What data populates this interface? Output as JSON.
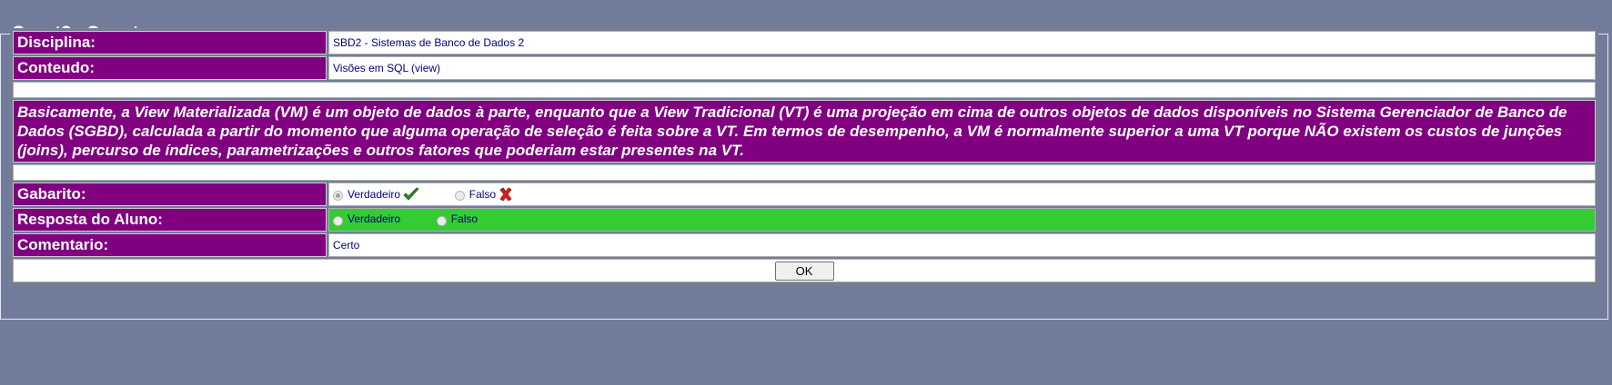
{
  "legend": "Quest?o Correta",
  "rows": {
    "disciplina_label": "Disciplina:",
    "disciplina_value": "SBD2 - Sistemas de Banco de Dados 2",
    "conteudo_label": "Conteudo:",
    "conteudo_value": "Visões em SQL (view)",
    "question_text": "Basicamente, a View Materializada (VM) é um objeto de dados à parte, enquanto que a View Tradicional (VT) é uma projeção em cima de outros objetos de dados disponíveis no Sistema Gerenciador de Banco de Dados (SGBD), calculada a partir do momento que alguma operação de seleção é feita sobre a VT.     Em termos de desempenho, a VM é normalmente superior a uma VT porque NÃO existem os custos de junções (joins), percurso de índices, parametrizações e outros fatores que poderiam estar presentes na VT.",
    "gabarito_label": "Gabarito:",
    "resposta_label": "Resposta do Aluno:",
    "comentario_label": "Comentario:",
    "comentario_value": "Certo"
  },
  "gabarito": {
    "option_true": "Verdadeiro",
    "option_false": "Falso",
    "selected": "Verdadeiro",
    "true_icon": "check-icon",
    "false_icon": "cross-icon"
  },
  "resposta": {
    "option_true": "Verdadeiro",
    "option_false": "Falso",
    "selected": null,
    "row_color": "#33cc33"
  },
  "ok_button": "OK",
  "colors": {
    "background": "#717c9c",
    "label_bg": "#800080",
    "answer_correct_bg": "#33cc33"
  }
}
